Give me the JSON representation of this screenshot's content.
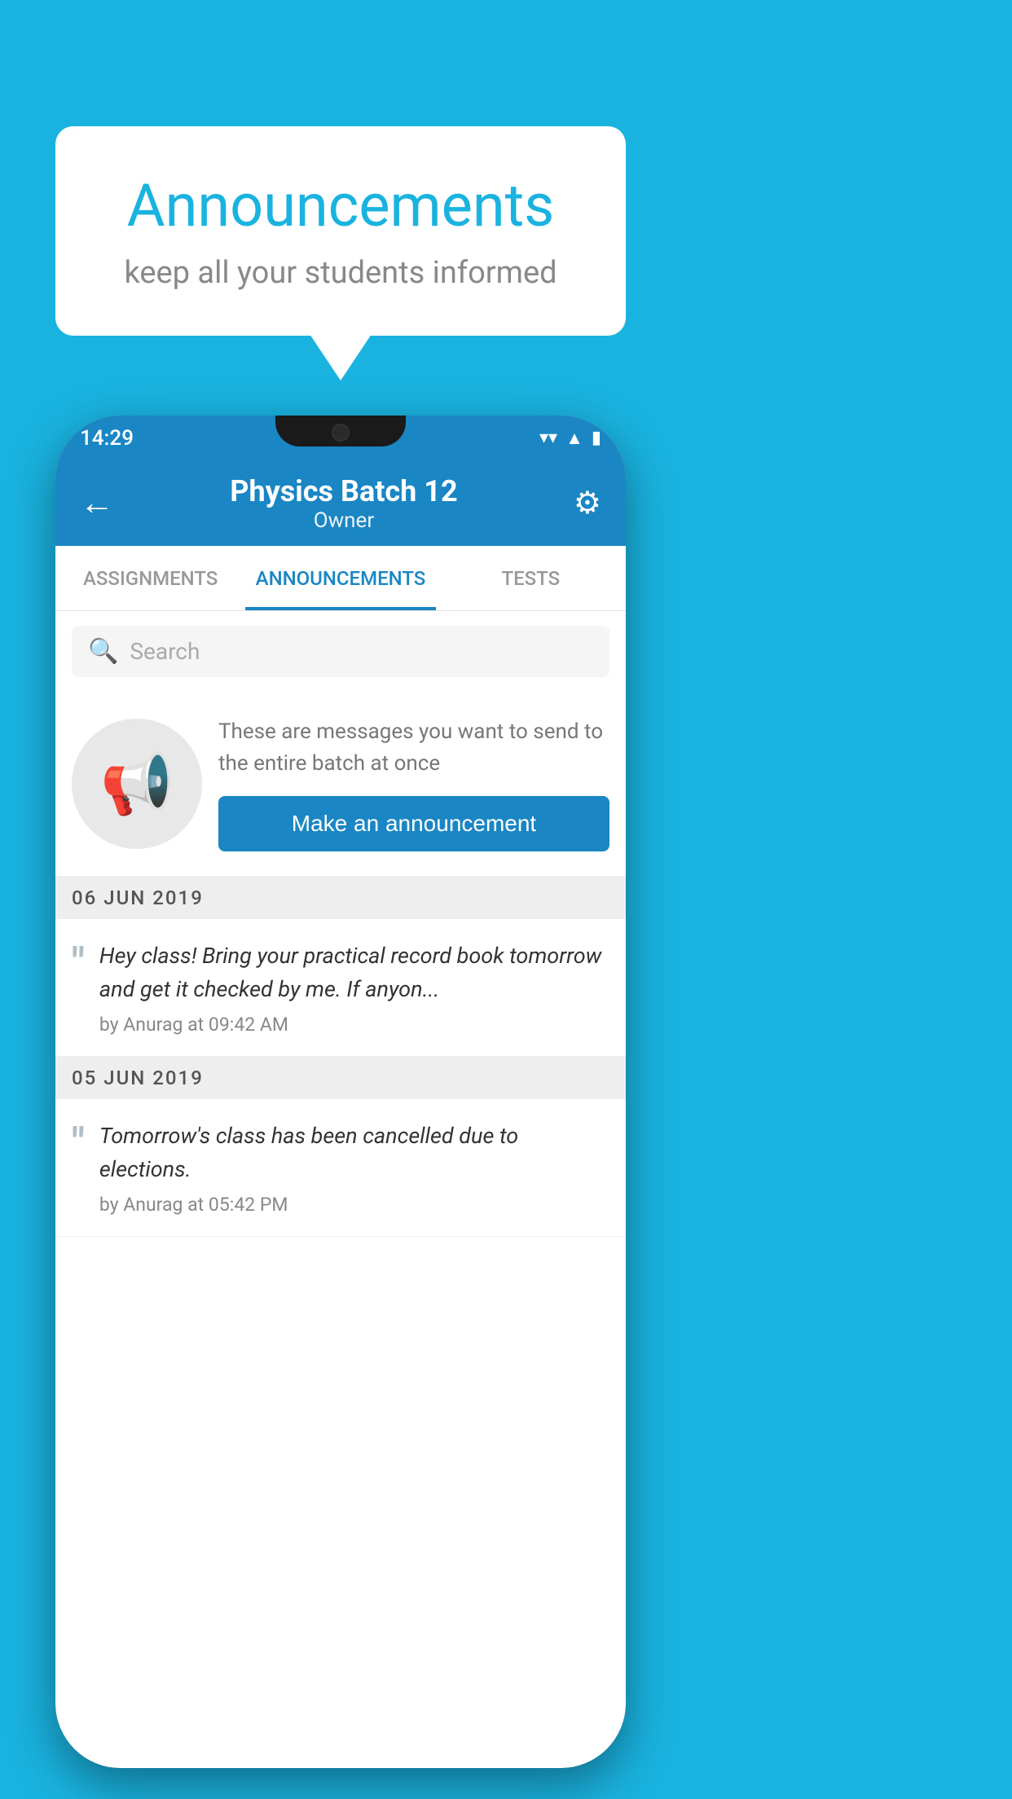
{
  "page": {
    "background_color": "#1ab3e0"
  },
  "speech_bubble": {
    "title": "Announcements",
    "subtitle": "keep all your students informed"
  },
  "status_bar": {
    "time": "14:29",
    "wifi_icon": "▼",
    "signal_icon": "▲",
    "battery_icon": "▮"
  },
  "app_bar": {
    "back_label": "←",
    "title": "Physics Batch 12",
    "subtitle": "Owner",
    "settings_icon": "⚙"
  },
  "tabs": [
    {
      "label": "ASSIGNMENTS",
      "active": false
    },
    {
      "label": "ANNOUNCEMENTS",
      "active": true
    },
    {
      "label": "TESTS",
      "active": false
    }
  ],
  "search": {
    "placeholder": "Search"
  },
  "promo_section": {
    "description_text": "These are messages you want to send to the entire batch at once",
    "button_label": "Make an announcement"
  },
  "announcements": [
    {
      "date_label": "06  JUN  2019",
      "text": "Hey class! Bring your practical record book tomorrow and get it checked by me. If anyon...",
      "meta": "by Anurag at 09:42 AM"
    },
    {
      "date_label": "05  JUN  2019",
      "text": "Tomorrow's class has been cancelled due to elections.",
      "meta": "by Anurag at 05:42 PM"
    }
  ]
}
